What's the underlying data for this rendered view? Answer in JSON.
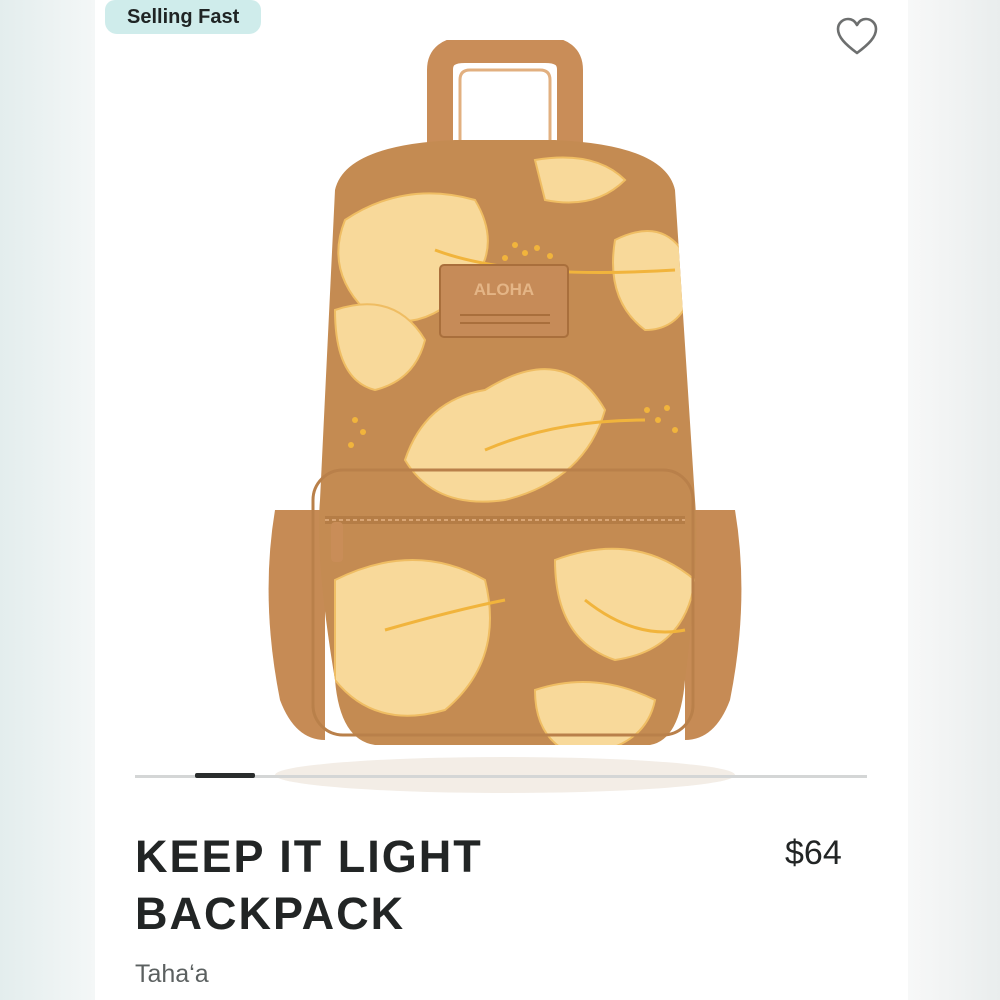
{
  "badge": {
    "label": "Selling Fast"
  },
  "favorite": {
    "icon": "heart-outline-icon"
  },
  "product": {
    "name": "KEEP IT LIGHT BACKPACK",
    "price": "$64",
    "variant": "Taha‘a",
    "logo_text": "ALOHA"
  },
  "carousel": {
    "current": 1
  },
  "colors": {
    "badge_bg": "#cfeceb",
    "bag_tan": "#c48b52",
    "flower": "#f8d99a",
    "text_dark": "#222525"
  }
}
